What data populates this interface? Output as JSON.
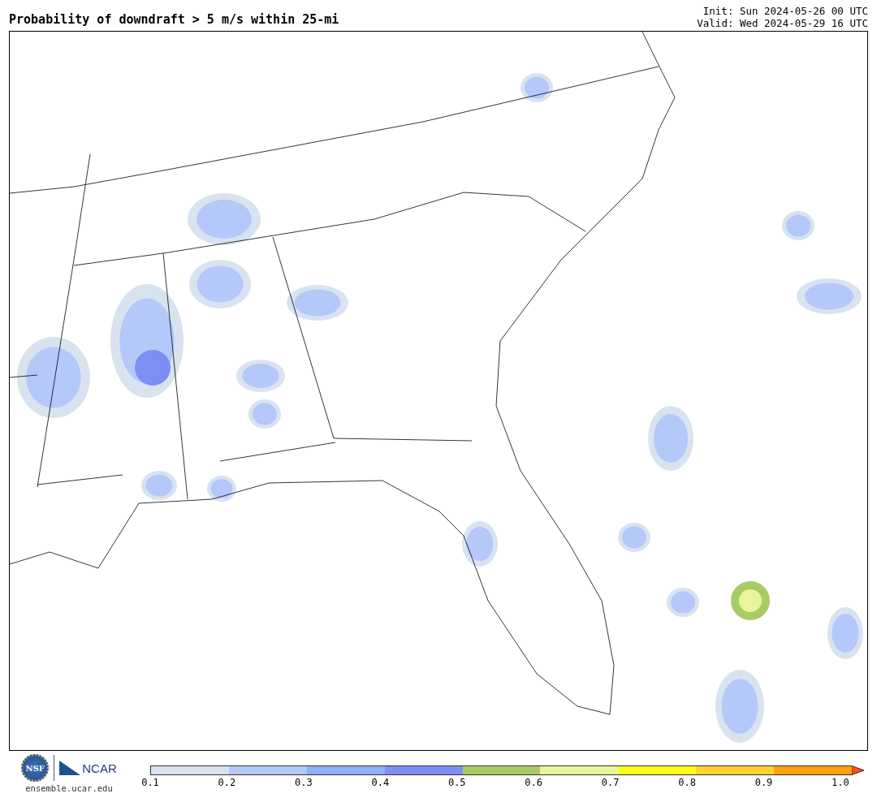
{
  "title": "Probability of downdraft > 5 m/s within 25-mi",
  "init": "Init: Sun 2024-05-26 00 UTC",
  "valid": "Valid: Wed 2024-05-29 16 UTC",
  "logos": {
    "nsf": "NSF",
    "ncar": "NCAR",
    "url": "ensemble.ucar.edu"
  },
  "colorbar": {
    "segments": [
      {
        "color": "#d8e3ef"
      },
      {
        "color": "#b4c8fa"
      },
      {
        "color": "#93aefa"
      },
      {
        "color": "#7b8ff5"
      },
      {
        "color": "#a8cc64"
      },
      {
        "color": "#e8f4a0"
      },
      {
        "color": "#ffff1a"
      },
      {
        "color": "#ffd230"
      },
      {
        "color": "#ffa010"
      }
    ],
    "extend_arrow": {
      "color": "#ff5010"
    },
    "ticks": [
      "0.1",
      "0.2",
      "0.3",
      "0.4",
      "0.5",
      "0.6",
      "0.7",
      "0.8",
      "0.9",
      "1.0"
    ]
  }
}
